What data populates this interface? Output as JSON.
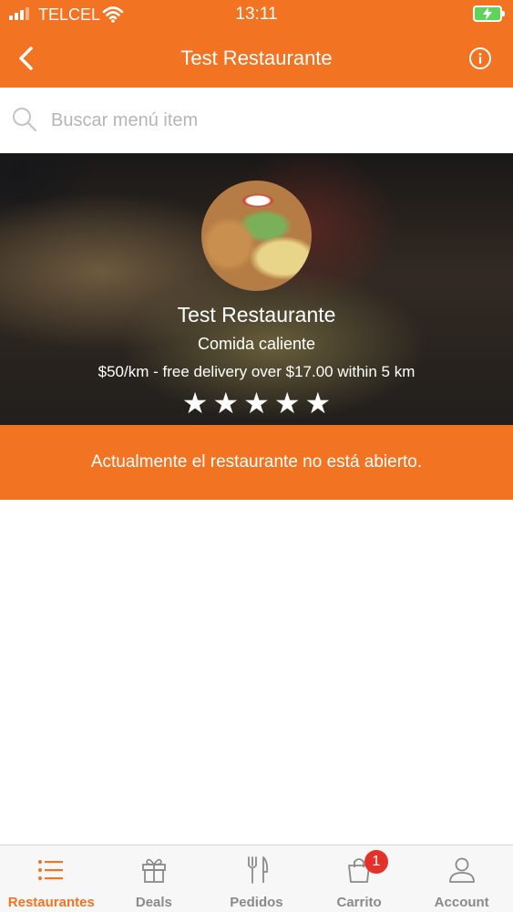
{
  "status_bar": {
    "carrier": "TELCEL",
    "time": "13:11"
  },
  "header": {
    "title": "Test Restaurante",
    "back_icon": "chevron-left-icon",
    "info_icon": "info-icon"
  },
  "search": {
    "placeholder": "Buscar menú item",
    "value": ""
  },
  "restaurant": {
    "name": "Test Restaurante",
    "category": "Comida caliente",
    "delivery_info": "$50/km - free delivery over $17.00 within 5 km",
    "rating": 5,
    "rating_max": 5
  },
  "notice": {
    "text": "Actualmente el restaurante no está abierto."
  },
  "tabs": [
    {
      "label": "Restaurantes",
      "icon": "list-icon",
      "active": true
    },
    {
      "label": "Deals",
      "icon": "gift-icon",
      "active": false
    },
    {
      "label": "Pedidos",
      "icon": "fork-knife-icon",
      "active": false
    },
    {
      "label": "Carrito",
      "icon": "shopping-bag-icon",
      "active": false,
      "badge": "1"
    },
    {
      "label": "Account",
      "icon": "user-icon",
      "active": false
    }
  ],
  "colors": {
    "primary": "#f27322",
    "badge": "#e4322b",
    "inactive_tab": "#8a8a8a"
  }
}
